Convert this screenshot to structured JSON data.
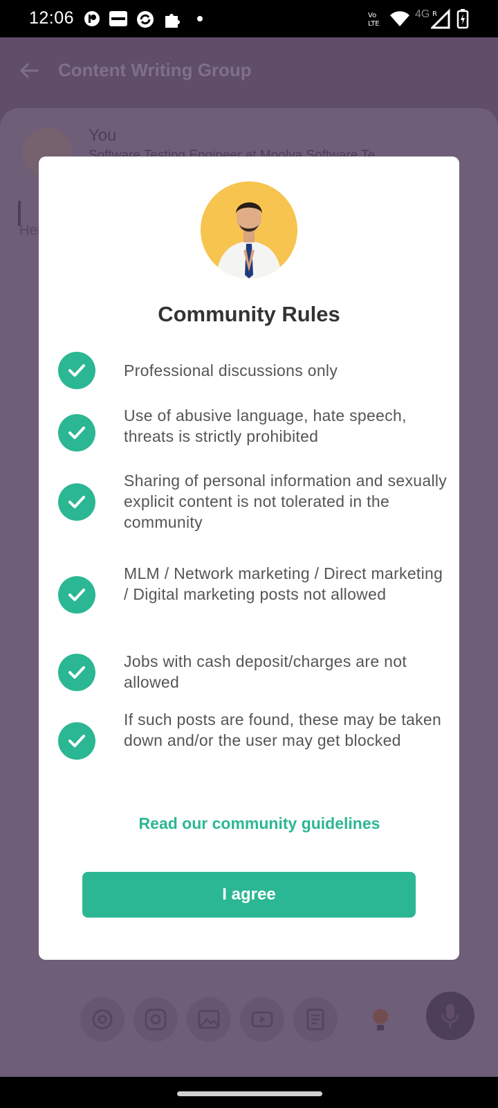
{
  "status_bar": {
    "time": "12:06",
    "network": "4G",
    "volte": "Vo LTE"
  },
  "app": {
    "title": "Content Writing Group",
    "user_name": "You",
    "user_subtitle": "Software Testing Engineer at Moolya Software Te",
    "post_placeholder": "Here"
  },
  "modal": {
    "title": "Community Rules",
    "rules": [
      "Professional discussions only",
      "Use of abusive language, hate speech, threats is strictly prohibited",
      "Sharing of personal information and sexually explicit content is not tolerated in the community",
      "MLM / Network marketing / Direct marketing / Digital marketing posts not allowed",
      "Jobs with cash deposit/charges are not allowed",
      " If such posts are found, these may be taken down and/or the user may get blocked"
    ],
    "guidelines_link": "Read our community guidelines",
    "agree_label": "I agree"
  },
  "colors": {
    "accent": "#2bb793",
    "avatar_bg": "#f7c44f"
  },
  "icons": {
    "tools": [
      "at-icon",
      "instagram-icon",
      "image-icon",
      "youtube-icon",
      "document-icon",
      "bulb-icon"
    ],
    "mic": "mic-icon"
  }
}
